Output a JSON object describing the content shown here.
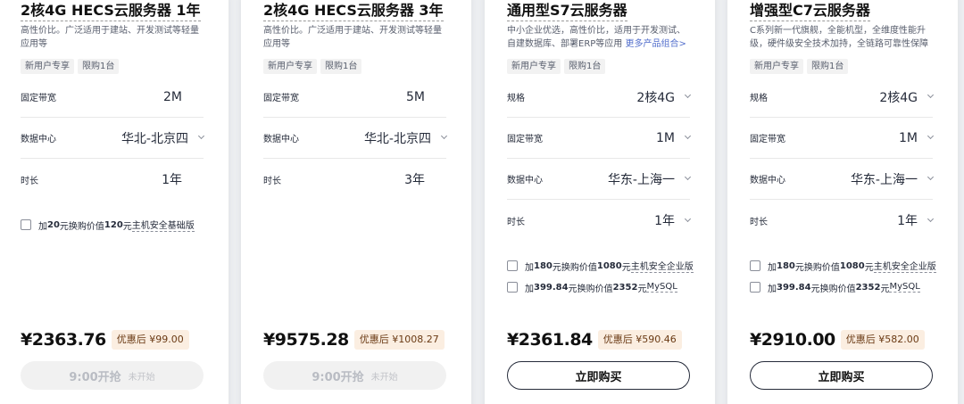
{
  "products": [
    {
      "title": "2核4G HECS云服务器 1年",
      "desc_lines": [
        "高性价比。广泛适用于建站、开发测试等轻量",
        "应用等"
      ],
      "desc_link": "",
      "tags": [
        "新用户专享",
        "限购1台"
      ],
      "specs": [
        {
          "label": "固定带宽",
          "value": "2M",
          "dropdown": false
        },
        {
          "label": "数据中心",
          "value": "华北-北京四",
          "dropdown": true
        },
        {
          "label": "时长",
          "value": "1年",
          "dropdown": false
        }
      ],
      "addons": [
        {
          "prefix": "加",
          "amount": "20",
          "mid": "元换购价值",
          "worth": "120",
          "suffix": "元",
          "product": "主机安全基础版"
        }
      ],
      "price": "¥2363.76",
      "discount": "优惠后 ¥99.00",
      "button": {
        "label": "9:00开抢",
        "sub": "未开始",
        "state": "disabled"
      }
    },
    {
      "title": "2核4G HECS云服务器 3年",
      "desc_lines": [
        "高性价比。广泛适用于建站、开发测试等轻量",
        "应用等"
      ],
      "desc_link": "",
      "tags": [
        "新用户专享",
        "限购1台"
      ],
      "specs": [
        {
          "label": "固定带宽",
          "value": "5M",
          "dropdown": false
        },
        {
          "label": "数据中心",
          "value": "华北-北京四",
          "dropdown": true
        },
        {
          "label": "时长",
          "value": "3年",
          "dropdown": false
        }
      ],
      "addons": [],
      "price": "¥9575.28",
      "discount": "优惠后 ¥1008.27",
      "button": {
        "label": "9:00开抢",
        "sub": "未开始",
        "state": "disabled"
      }
    },
    {
      "title": "通用型S7云服务器",
      "desc_lines": [
        "中小企业优选，高性价比，适用于开发测试、",
        "自建数据库、部署ERP等应用"
      ],
      "desc_link": "更多产品组合>",
      "tags": [
        "新用户专享",
        "限购1台"
      ],
      "specs": [
        {
          "label": "规格",
          "value": "2核4G",
          "dropdown": true
        },
        {
          "label": "固定带宽",
          "value": "1M",
          "dropdown": true
        },
        {
          "label": "数据中心",
          "value": "华东-上海一",
          "dropdown": true
        },
        {
          "label": "时长",
          "value": "1年",
          "dropdown": true
        }
      ],
      "addons": [
        {
          "prefix": "加",
          "amount": "180",
          "mid": "元换购价值",
          "worth": "1080",
          "suffix": "元",
          "product": "主机安全企业版"
        },
        {
          "prefix": "加",
          "amount": "399.84",
          "mid": "元换购价值",
          "worth": "2352",
          "suffix": "元",
          "product": "MySQL"
        }
      ],
      "price": "¥2361.84",
      "discount": "优惠后 ¥590.46",
      "button": {
        "label": "立即购买",
        "sub": "",
        "state": "active"
      }
    },
    {
      "title": "增强型C7云服务器",
      "desc_lines": [
        "C系列新一代旗舰，全能机型，全维度性能升",
        "级，硬件级安全技术加持，全链路可靠性保障"
      ],
      "desc_link": "",
      "tags": [
        "新用户专享",
        "限购1台"
      ],
      "specs": [
        {
          "label": "规格",
          "value": "2核4G",
          "dropdown": true
        },
        {
          "label": "固定带宽",
          "value": "1M",
          "dropdown": true
        },
        {
          "label": "数据中心",
          "value": "华东-上海一",
          "dropdown": true
        },
        {
          "label": "时长",
          "value": "1年",
          "dropdown": true
        }
      ],
      "addons": [
        {
          "prefix": "加",
          "amount": "180",
          "mid": "元换购价值",
          "worth": "1080",
          "suffix": "元",
          "product": "主机安全企业版"
        },
        {
          "prefix": "加",
          "amount": "399.84",
          "mid": "元换购价值",
          "worth": "2352",
          "suffix": "元",
          "product": "MySQL"
        }
      ],
      "price": "¥2910.00",
      "discount": "优惠后 ¥582.00",
      "button": {
        "label": "立即购买",
        "sub": "",
        "state": "active"
      }
    }
  ]
}
